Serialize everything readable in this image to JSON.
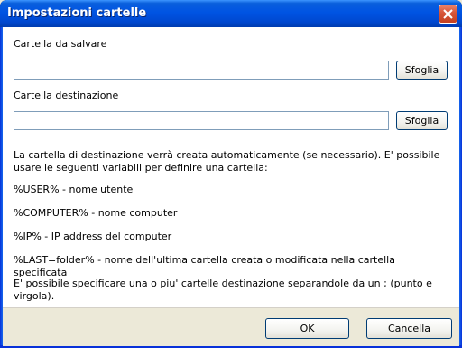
{
  "window": {
    "title": "Impostazioni cartelle",
    "close_icon": "close-icon",
    "colors": {
      "titlebar": "#0054e3",
      "client": "#ffffff",
      "footer": "#ece9d8",
      "input_border": "#7f9db9"
    }
  },
  "fields": {
    "source": {
      "label": "Cartella da salvare",
      "value": "",
      "button": "Sfoglia"
    },
    "destination": {
      "label": "Cartella destinazione",
      "value": "",
      "button": "Sfoglia"
    }
  },
  "info": {
    "intro": "La cartella di destinazione verrà creata automaticamente (se necessario). E' possibile usare le seguenti variabili per definire una cartella:",
    "var_user": "%USER% - nome utente",
    "var_computer": "%COMPUTER% - nome computer",
    "var_ip": "%IP% - IP address del computer",
    "var_last": "%LAST=folder% - nome dell'ultima cartella creata o modificata nella cartella specificata",
    "multiple": "E' possibile specificare una o piu' cartelle destinazione separandole da un ; (punto e virgola)."
  },
  "footer": {
    "ok": "OK",
    "cancel": "Cancella"
  }
}
